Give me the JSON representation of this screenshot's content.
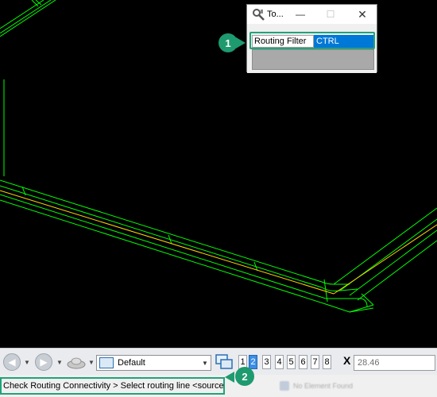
{
  "tool_window": {
    "title": "To...",
    "filter_label": "Routing Filter",
    "filter_value": "CTRL"
  },
  "callouts": {
    "first": "1",
    "second": "2"
  },
  "toolbar": {
    "view_dropdown": "Default",
    "view_numbers": [
      "1",
      "2",
      "3",
      "4",
      "5",
      "6",
      "7",
      "8"
    ],
    "active_view": "2",
    "coord_axis": "X",
    "coord_value": "28.46"
  },
  "status": {
    "prompt": "Check Routing Connectivity > Select routing line <source>:",
    "blurred_text": "No Element Found"
  },
  "colors": {
    "viewport_bg": "#000000",
    "routing_lines": "#00ff00",
    "center_line": "#ffd700",
    "callout": "#1e9a6f",
    "selection": "#0078d7"
  }
}
